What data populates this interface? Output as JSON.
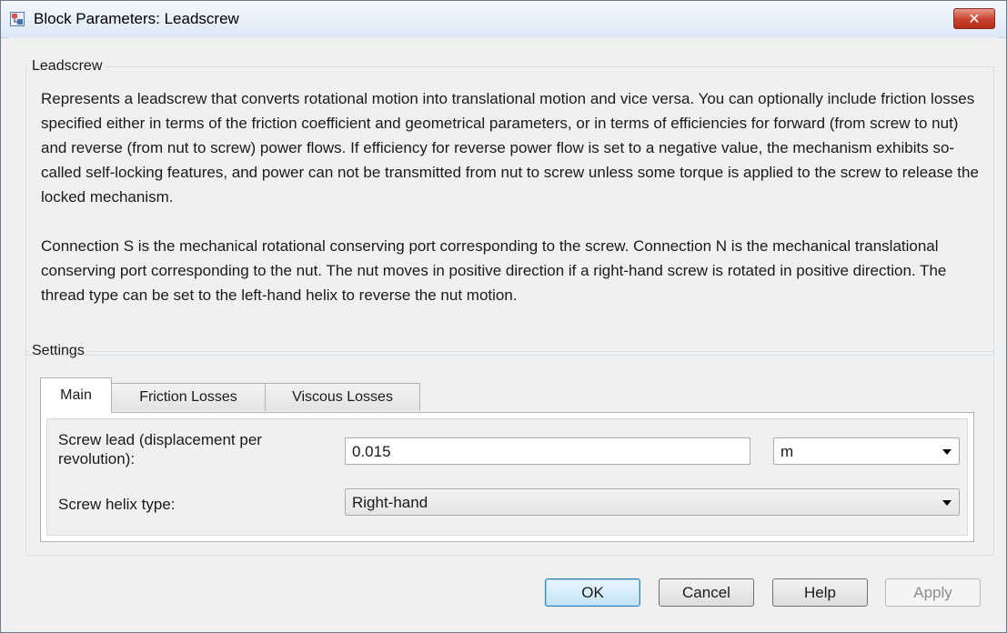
{
  "window": {
    "title": "Block Parameters: Leadscrew",
    "close_symbol": "✕"
  },
  "block": {
    "group_title": "Leadscrew",
    "description_1": "Represents a leadscrew that converts rotational motion into translational motion and vice versa. You can optionally include friction losses specified either in terms of the friction coefficient and geometrical parameters, or in terms of efficiencies for forward (from screw to nut) and reverse (from nut to screw) power flows. If efficiency for reverse power flow is set to a negative value, the mechanism exhibits so-called self-locking features, and power can not be transmitted from nut to screw unless some torque is applied to the screw to release the locked mechanism.",
    "description_2": "Connection S is the mechanical rotational conserving port corresponding to the screw. Connection N is the mechanical translational conserving port corresponding to the nut. The nut moves in positive direction if a right-hand screw is rotated in positive direction. The thread type can be set to the left-hand helix to reverse the nut motion."
  },
  "settings": {
    "group_title": "Settings",
    "tabs": [
      {
        "label": "Main",
        "active": true
      },
      {
        "label": "Friction Losses",
        "active": false
      },
      {
        "label": "Viscous Losses",
        "active": false
      }
    ],
    "params": {
      "screw_lead_label_line1": "Screw lead (displacement per",
      "screw_lead_label_line2": "revolution):",
      "screw_lead_value": "0.015",
      "screw_lead_unit": "m",
      "helix_label": "Screw helix type:",
      "helix_value": "Right-hand"
    }
  },
  "buttons": {
    "ok": "OK",
    "cancel": "Cancel",
    "help": "Help",
    "apply": "Apply"
  },
  "icons": {
    "app": "simulink-block-icon",
    "close": "close-icon",
    "dropdown": "chevron-down-icon"
  },
  "colors": {
    "close_button": "#c8412d",
    "default_button_border": "#3c7fb1",
    "disabled_text": "#8d8d8d"
  }
}
